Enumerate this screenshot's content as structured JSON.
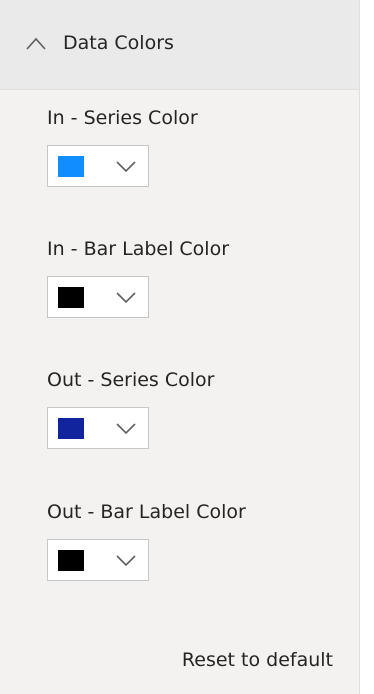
{
  "section": {
    "title": "Data Colors",
    "expand_icon": "chevron-up-icon"
  },
  "settings": [
    {
      "label": "In - Series Color",
      "color": "#118dff",
      "dropdown_icon": "chevron-down-icon"
    },
    {
      "label": "In - Bar Label Color",
      "color": "#000000",
      "dropdown_icon": "chevron-down-icon"
    },
    {
      "label": "Out - Series Color",
      "color": "#12239e",
      "dropdown_icon": "chevron-down-icon"
    },
    {
      "label": "Out - Bar Label Color",
      "color": "#000000",
      "dropdown_icon": "chevron-down-icon"
    }
  ],
  "reset": {
    "label": "Reset to default"
  }
}
